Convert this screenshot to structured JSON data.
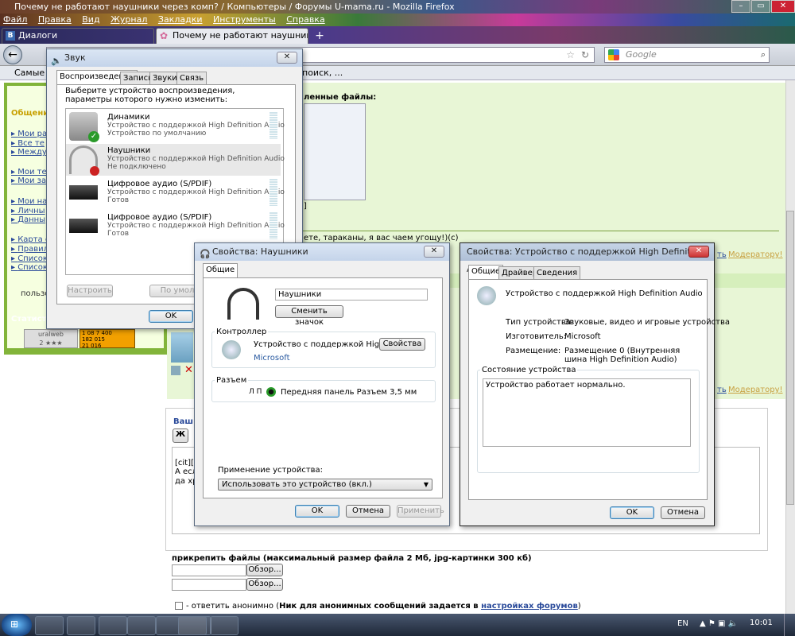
{
  "browser": {
    "title": "Почему не работают наушники через комп? / Компьютеры / Форумы U-mama.ru - Mozilla Firefox",
    "menu": [
      "Файл",
      "Правка",
      "Вид",
      "Журнал",
      "Закладки",
      "Инструменты",
      "Справка"
    ],
    "tabs": [
      "Диалоги",
      "Почему не работают наушники че..."
    ],
    "search_placeholder": "Google",
    "bookmark": "Самые по",
    "bookmark2": "поиск, ...",
    "new_tab": "+"
  },
  "page": {
    "sidebar_heading": "Общение",
    "links_a": [
      "Мои ра",
      "Все те",
      "Между"
    ],
    "links_b": [
      "Мои те",
      "Мои за"
    ],
    "links_c": [
      "Мои на",
      "Личны",
      "Данны"
    ],
    "links_d": [
      "Карта с",
      "Правил",
      "Список",
      "Список"
    ],
    "user_label": "пользо",
    "stats_label": "Статисти",
    "counter_name": "uralweb",
    "counter_stars": "2 ★★★",
    "counter_nums": "1 08 7 400\n182 015\n21 016",
    "attached_label": "ленные файлы:",
    "quote_tail": "ете, тараканы, я вас чаем угощу!)(с)",
    "bracket": "]",
    "answer": "ть",
    "moderator": "Модератору!",
    "your": "Ваш",
    "bold_btn": "Ж",
    "editor_lines": [
      "[cit][",
      "А есл",
      "да хр"
    ],
    "attach_text": "прикрепить файлы (максимальный размер файла 2 Мб, jpg-картинки 300 кб)",
    "browse": "Обзор...",
    "anon_prefix": "- ответить анонимно (",
    "anon_bold": "Ник для анонимных сообщений задается в ",
    "anon_link": "настройках форумов",
    "anon_close": ")"
  },
  "sound": {
    "title": "Звук",
    "tabs": [
      "Воспроизведение",
      "Запись",
      "Звуки",
      "Связь"
    ],
    "prompt": "Выберите устройство воспроизведения, параметры которого нужно изменить:",
    "devices": [
      {
        "name": "Динамики",
        "line2": "Устройство с поддержкой High Definition Audio",
        "line3": "Устройство по умолчанию"
      },
      {
        "name": "Наушники",
        "line2": "Устройство с поддержкой High Definition Audio",
        "line3": "Не подключено"
      },
      {
        "name": "Цифровое аудио (S/PDIF)",
        "line2": "Устройство с поддержкой High Definition Audio",
        "line3": "Готов"
      },
      {
        "name": "Цифровое аудио (S/PDIF)",
        "line2": "Устройство с поддержкой High Definition Audio",
        "line3": "Готов"
      }
    ],
    "configure": "Настроить",
    "default": "По умол",
    "ok": "OK",
    "close": "✕"
  },
  "headphones": {
    "title": "Свойства: Наушники",
    "tab": "Общие",
    "name_value": "Наушники",
    "change_icon": "Сменить значок",
    "controller_label": "Контроллер",
    "controller_name": "Устройство с поддержкой High Defi...",
    "controller_vendor": "Microsoft",
    "properties": "Свойства",
    "jack_label": "Разъем",
    "jack_lr": "Л П",
    "jack_value": "Передняя панель Разъем 3,5 мм",
    "usage_label": "Применение устройства:",
    "usage_value": "Использовать это устройство (вкл.)",
    "ok": "OK",
    "cancel": "Отмена",
    "apply": "Применить",
    "close": "✕"
  },
  "hda": {
    "title": "Свойства: Устройство с поддержкой High Definition Audio",
    "tabs": [
      "Общие",
      "Драйвер",
      "Сведения"
    ],
    "device_name": "Устройство с поддержкой High Definition Audio",
    "type_label": "Тип устройства:",
    "type_value": "Звуковые, видео и игровые устройства",
    "maker_label": "Изготовитель:",
    "maker_value": "Microsoft",
    "place_label": "Размещение:",
    "place_value": "Размещение 0 (Внутренняя шина High Definition Audio)",
    "status_label": "Состояние устройства",
    "status_value": "Устройство работает нормально.",
    "ok": "OK",
    "cancel": "Отмена",
    "close": "✕"
  },
  "taskbar": {
    "lang": "EN",
    "clock": "10:01"
  },
  "colors": {
    "accent": "#82b43a",
    "link": "#2a4a9a",
    "moderator": "#c8a040"
  }
}
